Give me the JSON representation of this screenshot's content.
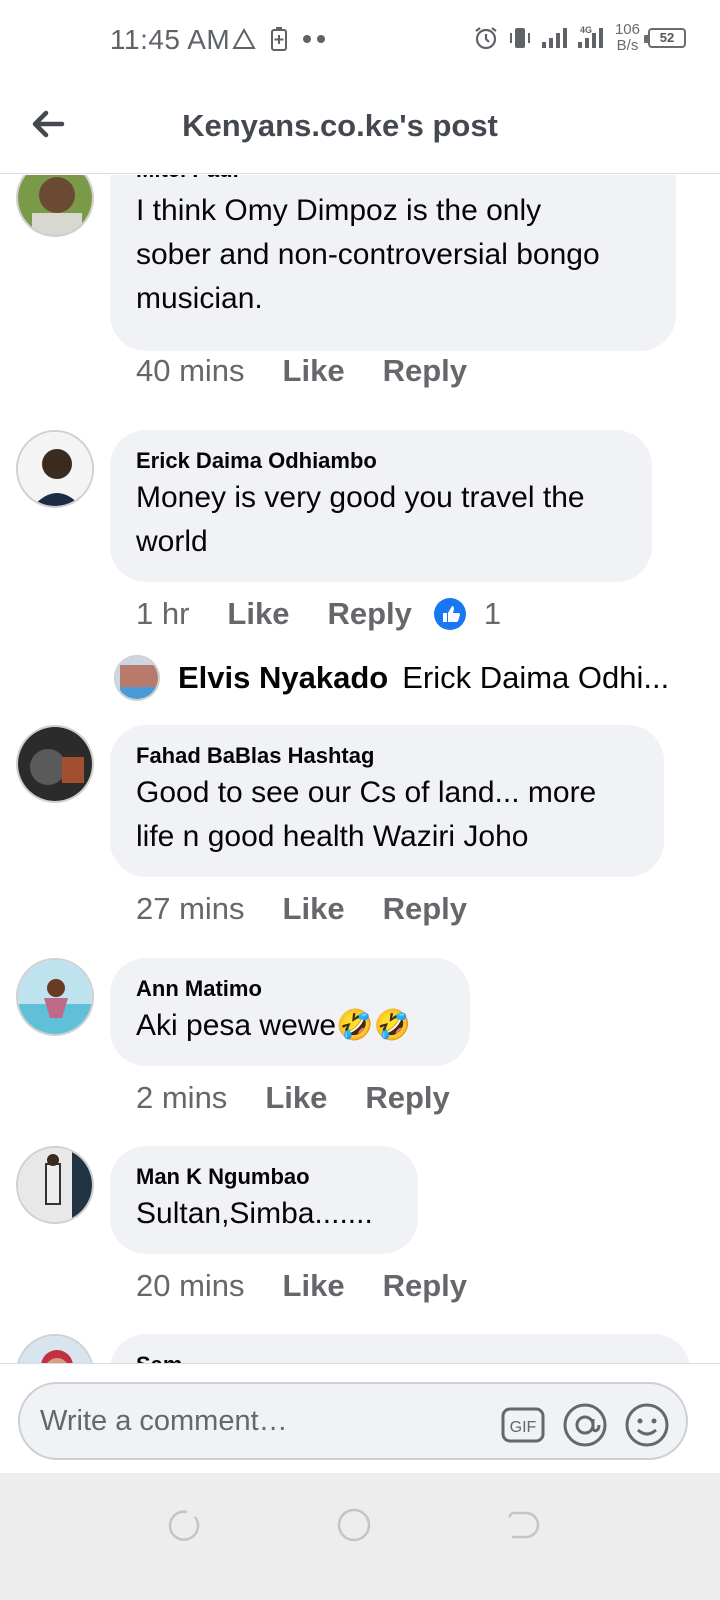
{
  "status_bar": {
    "time": "11:45 AM",
    "net_speed_value": "106",
    "net_speed_unit": "B/s",
    "network_label": "4G",
    "battery": "52"
  },
  "header": {
    "title": "Kenyans.co.ke's post"
  },
  "comments": [
    {
      "author": "Mitei Paul",
      "text_lines": [
        "I think Omy Dimpoz is the only",
        "sober and non-controversial bongo",
        "musician."
      ],
      "time": "40 mins",
      "like_label": "Like",
      "reply_label": "Reply"
    },
    {
      "author": "Erick Daima Odhiambo",
      "text_lines": [
        "Money is very good you travel the",
        "world"
      ],
      "time": "1 hr",
      "like_label": "Like",
      "reply_label": "Reply",
      "reaction_count": "1"
    },
    {
      "author": "Fahad BaBlas Hashtag",
      "text_lines": [
        "Good to see our Cs of land... more",
        "life n good health Waziri Joho"
      ],
      "time": "27 mins",
      "like_label": "Like",
      "reply_label": "Reply"
    },
    {
      "author": "Ann Matimo",
      "text_lines": [
        "Aki pesa wewe🤣🤣"
      ],
      "time": "2 mins",
      "like_label": "Like",
      "reply_label": "Reply"
    },
    {
      "author": "Man K Ngumbao",
      "text_lines": [
        "Sultan,Simba......."
      ],
      "time": "20 mins",
      "like_label": "Like",
      "reply_label": "Reply"
    },
    {
      "author": "Sam"
    }
  ],
  "reply_preview": {
    "author": "Elvis Nyakado",
    "text": "Erick Daima Odhi..."
  },
  "composer": {
    "placeholder": "Write a comment…",
    "gif_label": "GIF"
  }
}
